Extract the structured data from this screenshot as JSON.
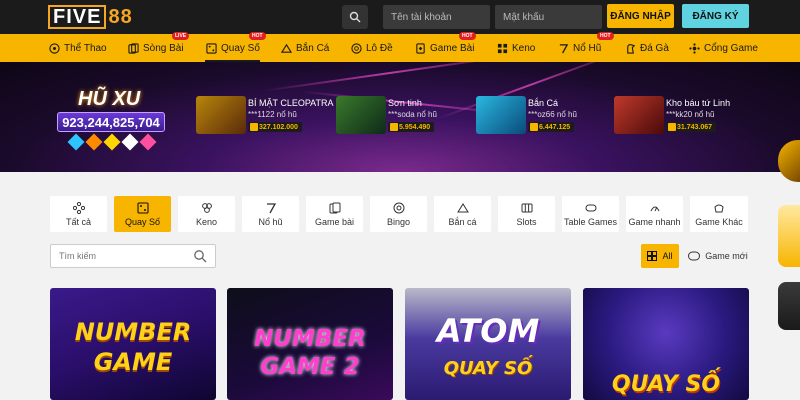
{
  "header": {
    "logo_part1": "FIVE",
    "logo_part2": "88",
    "username_placeholder": "Tên tài khoản",
    "password_placeholder": "Mật khẩu",
    "login_label": "ĐĂNG NHẬP",
    "register_label": "ĐĂNG KÝ"
  },
  "nav": {
    "items": [
      {
        "label": "Thể Thao",
        "icon": "soccer-ball-icon",
        "badge": ""
      },
      {
        "label": "Sòng Bài",
        "icon": "cards-icon",
        "badge": "LIVE"
      },
      {
        "label": "Quay Số",
        "icon": "lottery-icon",
        "badge": "HOT"
      },
      {
        "label": "Bắn Cá",
        "icon": "fish-icon",
        "badge": ""
      },
      {
        "label": "Lô Đề",
        "icon": "number-balls-icon",
        "badge": ""
      },
      {
        "label": "Game Bài",
        "icon": "playing-card-icon",
        "badge": "HOT"
      },
      {
        "label": "Keno",
        "icon": "keno-icon",
        "badge": ""
      },
      {
        "label": "Nổ Hũ",
        "icon": "slot-icon",
        "badge": "HOT"
      },
      {
        "label": "Đá Gà",
        "icon": "rooster-icon",
        "badge": ""
      },
      {
        "label": "Cổng Game",
        "icon": "gamepad-icon",
        "badge": ""
      }
    ],
    "active_index": 2
  },
  "banner": {
    "hu_title": "HŨ XU",
    "hu_amount": "923,244,825,704",
    "jackpots": [
      {
        "name": "BÍ MẬT CLEOPATRA",
        "user": "***1122 nổ hũ",
        "amount": "327.102.000"
      },
      {
        "name": "Sơn tinh",
        "user": "***soda nổ hũ",
        "amount": "5.954.490"
      },
      {
        "name": "Bắn Cá",
        "user": "***oz66 nổ hũ",
        "amount": "6.447.125"
      },
      {
        "name": "Kho báu tứ Linh",
        "user": "***kk20 nổ hũ",
        "amount": "31.743.067"
      }
    ]
  },
  "categories": {
    "items": [
      {
        "label": "Tất cả",
        "icon": "grid-dots-icon"
      },
      {
        "label": "Quay Số",
        "icon": "lottery-icon"
      },
      {
        "label": "Keno",
        "icon": "keno-icon"
      },
      {
        "label": "Nổ hũ",
        "icon": "slot-seven-icon"
      },
      {
        "label": "Game bài",
        "icon": "playing-card-icon"
      },
      {
        "label": "Bingo",
        "icon": "bingo-icon"
      },
      {
        "label": "Bắn cá",
        "icon": "fish-icon"
      },
      {
        "label": "Slots",
        "icon": "slots-icon"
      },
      {
        "label": "Table Games",
        "icon": "table-icon"
      },
      {
        "label": "Game nhanh",
        "icon": "fast-game-icon"
      },
      {
        "label": "Game Khác",
        "icon": "other-games-icon"
      }
    ],
    "active_index": 1
  },
  "filters": {
    "search_placeholder": "Tìm kiếm",
    "all_label": "All",
    "new_label": "Game mới"
  },
  "games": [
    {
      "title_line1": "NUMBER",
      "title_line2": "GAME"
    },
    {
      "title_line1": "NUMBER",
      "title_line2": "GAME 2"
    },
    {
      "title_line1": "ATOM",
      "title_line2": "QUAY SỐ"
    },
    {
      "title_line1": "",
      "title_line2": "QUAY SỐ"
    }
  ],
  "colors": {
    "accent": "#f7b500",
    "topbar": "#1b1b1b",
    "register": "#5fd4e0"
  }
}
